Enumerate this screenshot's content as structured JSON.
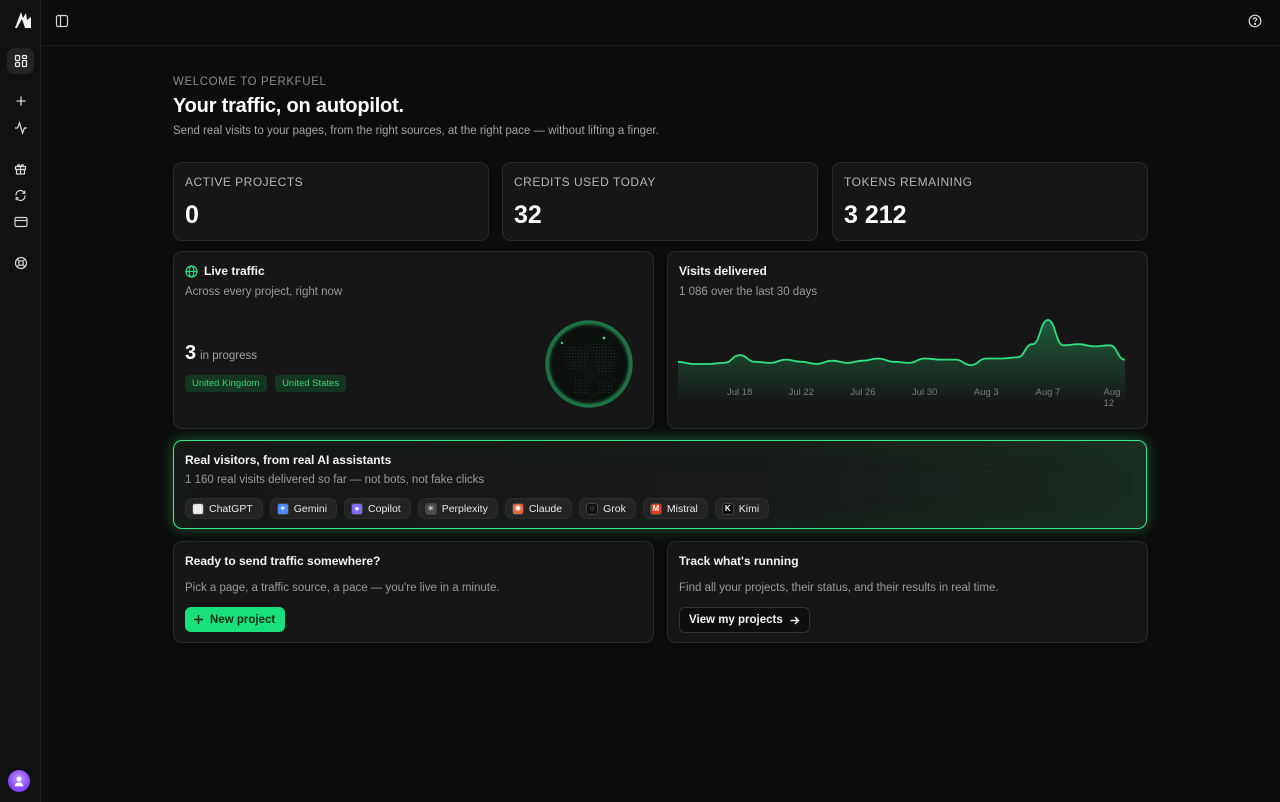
{
  "app": {
    "eyebrow": "WELCOME TO PERKFUEL",
    "title": "Your traffic, on autopilot.",
    "subtitle": "Send real visits to your pages, from the right sources, at the right pace — without lifting a finger."
  },
  "sidebar": {
    "items": [
      {
        "icon": "dashboard-icon",
        "active": true
      },
      {
        "icon": "plus-icon"
      },
      {
        "icon": "activity-icon"
      },
      {
        "icon": "gift-icon"
      },
      {
        "icon": "refresh-icon"
      },
      {
        "icon": "credit-card-icon"
      },
      {
        "icon": "support-icon"
      }
    ]
  },
  "stats": [
    {
      "label": "ACTIVE PROJECTS",
      "value": "0"
    },
    {
      "label": "CREDITS USED TODAY",
      "value": "32"
    },
    {
      "label": "TOKENS REMAINING",
      "value": "3 212"
    }
  ],
  "live": {
    "title": "Live traffic",
    "subtitle": "Across every project, right now",
    "count": "3",
    "count_label": "in progress",
    "countries": [
      "United Kingdom",
      "United States"
    ]
  },
  "visits": {
    "title": "Visits delivered",
    "subtitle": "1 086 over the last 30 days",
    "accent": "#2fe083",
    "chart_data": {
      "type": "area",
      "x": [
        "Jul 14",
        "Jul 15",
        "Jul 16",
        "Jul 17",
        "Jul 18",
        "Jul 19",
        "Jul 20",
        "Jul 21",
        "Jul 22",
        "Jul 23",
        "Jul 24",
        "Jul 25",
        "Jul 26",
        "Jul 27",
        "Jul 28",
        "Jul 29",
        "Jul 30",
        "Jul 31",
        "Aug 1",
        "Aug 2",
        "Aug 3",
        "Aug 4",
        "Aug 5",
        "Aug 6",
        "Aug 7",
        "Aug 8",
        "Aug 9",
        "Aug 10",
        "Aug 11",
        "Aug 12"
      ],
      "values": [
        22,
        20,
        20,
        21,
        28,
        22,
        21,
        24,
        22,
        20,
        23,
        21,
        23,
        25,
        22,
        21,
        25,
        24,
        24,
        19,
        25,
        25,
        26,
        38,
        60,
        37,
        38,
        36,
        37,
        24
      ],
      "tick_labels": [
        "Jul 18",
        "Jul 22",
        "Jul 26",
        "Jul 30",
        "Aug 3",
        "Aug 7",
        "Aug 12"
      ]
    }
  },
  "assistants": {
    "title": "Real visitors, from real AI assistants",
    "subtitle": "1 160 real visits delivered so far — not bots, not fake clicks",
    "items": [
      {
        "name": "ChatGPT",
        "icon": "chatgpt-icon",
        "color": "#e5e5e5",
        "glyph": "◎"
      },
      {
        "name": "Gemini",
        "icon": "gemini-icon",
        "color": "#4a8cff",
        "glyph": "✦"
      },
      {
        "name": "Copilot",
        "icon": "copilot-icon",
        "color": "#7e6cff",
        "glyph": "●"
      },
      {
        "name": "Perplexity",
        "icon": "perplexity-icon",
        "color": "#4b4b4b",
        "glyph": "✳"
      },
      {
        "name": "Claude",
        "icon": "claude-icon",
        "color": "#e0673d",
        "glyph": "✺"
      },
      {
        "name": "Grok",
        "icon": "grok-icon",
        "color": "#101010",
        "glyph": "◌"
      },
      {
        "name": "Mistral",
        "icon": "mistral-icon",
        "color": "#e83a1c",
        "glyph": "M"
      },
      {
        "name": "Kimi",
        "icon": "kimi-icon",
        "color": "#0a0a0a",
        "glyph": "K"
      }
    ]
  },
  "cta_new": {
    "title": "Ready to send traffic somewhere?",
    "subtitle": "Pick a page, a traffic source, a pace — you're live in a minute.",
    "button": "New project"
  },
  "cta_view": {
    "title": "Track what's running",
    "subtitle": "Find all your projects, their status, and their results in real time.",
    "button": "View my projects"
  }
}
